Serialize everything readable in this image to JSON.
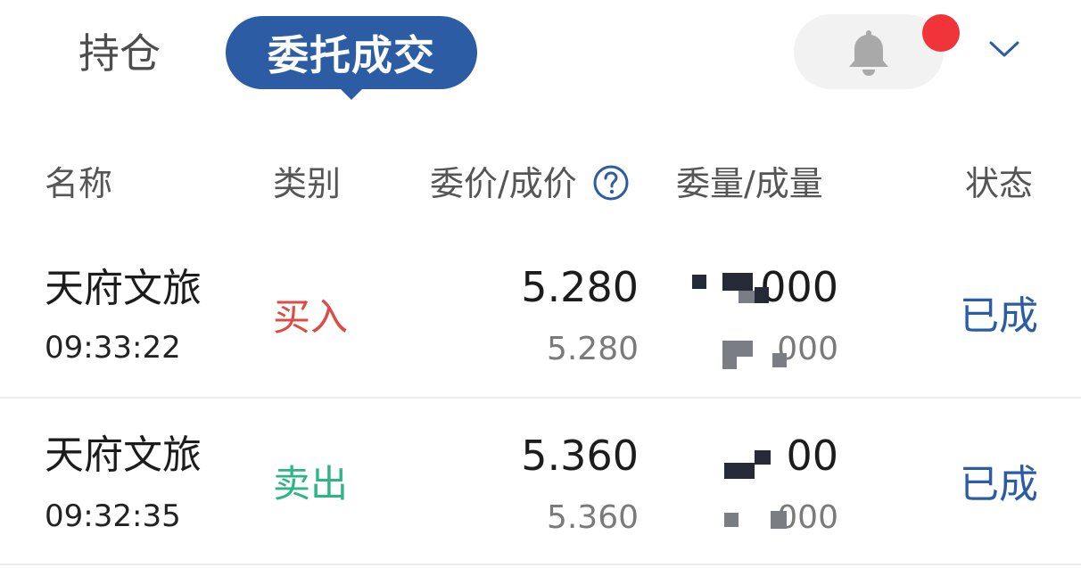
{
  "tabs": {
    "holdings": "持仓",
    "orders_trades": "委托成交"
  },
  "header": {
    "name": "名称",
    "type": "类别",
    "price": "委价/成价",
    "quantity": "委量/成量",
    "status": "状态"
  },
  "icons": {
    "bell": "bell-icon",
    "notification_dot": "red-dot",
    "expand": "chevron-down-icon",
    "help": "question-circle-icon"
  },
  "colors": {
    "accent": "#2c5ca4",
    "buy": "#e04a44",
    "sell": "#2fb488",
    "badge": "#f0343a"
  },
  "rows": [
    {
      "name": "天府文旅",
      "time": "09:33:22",
      "side": "买入",
      "order_price": "5.280",
      "fill_price": "5.280",
      "order_qty": "000",
      "fill_qty": "000",
      "status": "已成"
    },
    {
      "name": "天府文旅",
      "time": "09:32:35",
      "side": "卖出",
      "order_price": "5.360",
      "fill_price": "5.360",
      "order_qty": "00",
      "fill_qty": "000",
      "status": "已成"
    }
  ]
}
